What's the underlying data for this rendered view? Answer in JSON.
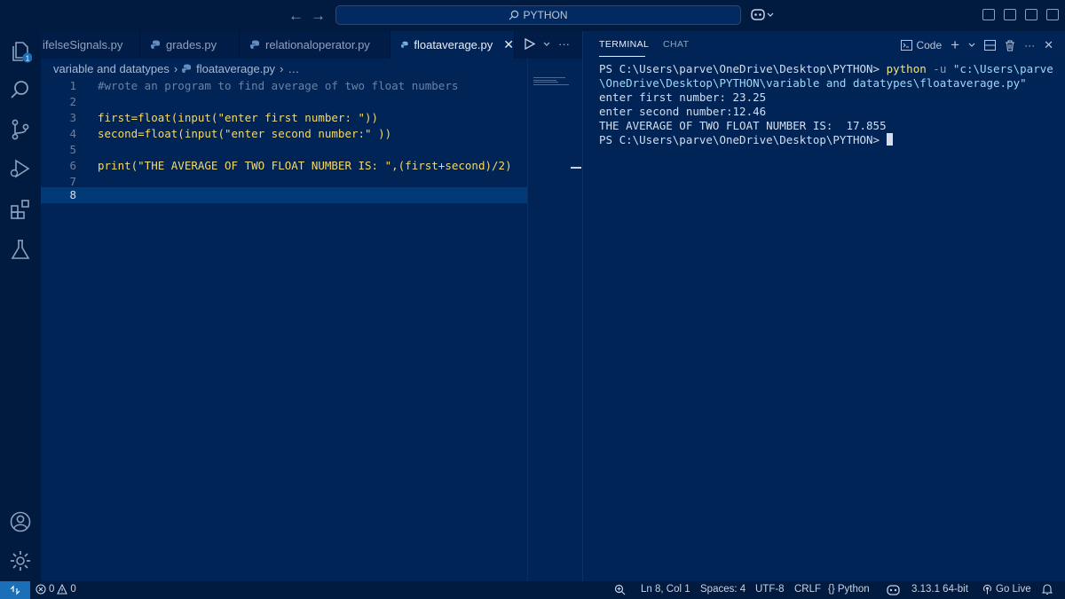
{
  "titlebar": {
    "search_text": "PYTHON",
    "back_icon": "arrow-left-icon",
    "forward_icon": "arrow-right-icon"
  },
  "editor": {
    "tabs": [
      {
        "label": "ifelseSignals.py",
        "active": false
      },
      {
        "label": "grades.py",
        "active": false
      },
      {
        "label": "relationaloperator.py",
        "active": false
      },
      {
        "label": "floataverage.py",
        "active": true
      }
    ],
    "close_symbol": "✕",
    "breadcrumb": {
      "folder": "variable and datatypes",
      "file": "floataverage.py",
      "more": "…"
    },
    "current_line": 8,
    "lines": [
      {
        "n": "1",
        "text": "#wrote an program to find average of two float numbers"
      },
      {
        "n": "2",
        "text": ""
      },
      {
        "n": "3",
        "text": "first=float(input(\"enter first number: \"))"
      },
      {
        "n": "4",
        "text": "second=float(input(\"enter second number:\" ))"
      },
      {
        "n": "5",
        "text": ""
      },
      {
        "n": "6",
        "text": "print(\"THE AVERAGE OF TWO FLOAT NUMBER IS: \",(first+second)/2)"
      },
      {
        "n": "7",
        "text": ""
      },
      {
        "n": "8",
        "text": ""
      }
    ]
  },
  "panel": {
    "tabs": [
      {
        "label": "TERMINAL",
        "active": true
      },
      {
        "label": "CHAT",
        "active": false
      }
    ],
    "actions": {
      "shell_label": "Code",
      "more": "···"
    },
    "terminal": {
      "prompt": "PS C:\\Users\\parve\\OneDrive\\Desktop\\PYTHON>",
      "command": "python",
      "flag": "-u",
      "arg_line1": "\"c:\\Users\\parve",
      "arg_line2": "\\OneDrive\\Desktop\\PYTHON\\variable and datatypes\\floataverage.py\"",
      "output": [
        "enter first number: 23.25",
        "enter second number:12.46",
        "THE AVERAGE OF TWO FLOAT NUMBER IS:  17.855"
      ],
      "final_prompt": "PS C:\\Users\\parve\\OneDrive\\Desktop\\PYTHON>"
    }
  },
  "statusbar": {
    "errors": "0",
    "warnings": "0",
    "cursor_position": "Ln 8, Col 1",
    "spaces": "Spaces: 4",
    "encoding": "UTF-8",
    "eol": "CRLF",
    "language": "Python",
    "interpreter": "3.13.1 64-bit",
    "golive": "Go Live"
  },
  "activitybar": {
    "explorer_badge": "1"
  },
  "colors": {
    "background": "#012456",
    "accent": "#1b6fb8"
  }
}
